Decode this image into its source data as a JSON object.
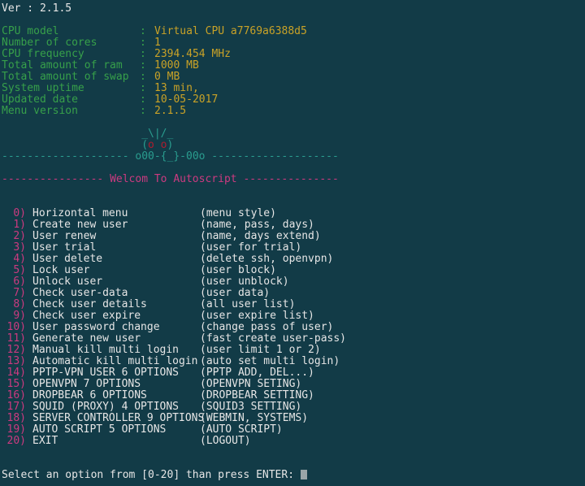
{
  "terminal": {
    "background_color": "#123b47",
    "version_line": "Ver : 2.1.5"
  },
  "colors": {
    "white": "#e6e6e6",
    "green": "#37a04a",
    "yellow": "#c9a227",
    "magenta": "#cc3a80",
    "cyan": "#2a9d8f",
    "red": "#b01c2e",
    "cursor": "#9aa5a8"
  },
  "system_info": {
    "separator": ":",
    "rows": [
      {
        "label": "CPU model",
        "value": "Virtual CPU a7769a6388d5"
      },
      {
        "label": "Number of cores",
        "value": "1"
      },
      {
        "label": "CPU frequency",
        "value": "2394.454 MHz"
      },
      {
        "label": "Total amount of ram",
        "value": "1000 MB"
      },
      {
        "label": "Total amount of swap",
        "value": "0 MB"
      },
      {
        "label": "System uptime",
        "value": "13 min,"
      },
      {
        "label": "Updated date",
        "value": "10-05-2017"
      },
      {
        "label": "Menu version",
        "value": "2.1.5"
      }
    ]
  },
  "ascii_art": {
    "ears": "_\\|/_",
    "face_left": "(",
    "eye_left": "o",
    "face_mid": " ",
    "eye_right": "o",
    "face_right": ")",
    "banner_left_dashes": "--------------------",
    "banner_center": "o00-{_}-00o",
    "banner_right_dashes": "--------------------",
    "welcome_left_dashes": "----------------",
    "welcome_text": "Welcom To Autoscript",
    "welcome_right_dashes": "---------------"
  },
  "menu": {
    "options": [
      {
        "num": "0)",
        "name": "Horizontal menu",
        "desc": "(menu style)"
      },
      {
        "num": "1)",
        "name": "Create new user",
        "desc": "(name, pass, days)"
      },
      {
        "num": "2)",
        "name": "User renew",
        "desc": "(name, days extend)"
      },
      {
        "num": "3)",
        "name": "User trial",
        "desc": "(user for trial)"
      },
      {
        "num": "4)",
        "name": "User delete",
        "desc": "(delete ssh, openvpn)"
      },
      {
        "num": "5)",
        "name": "Lock user",
        "desc": "(user block)"
      },
      {
        "num": "6)",
        "name": "Unlock user",
        "desc": "(user unblock)"
      },
      {
        "num": "7)",
        "name": "Check user-data",
        "desc": "(user data)"
      },
      {
        "num": "8)",
        "name": "Check user details",
        "desc": "(all user list)"
      },
      {
        "num": "9)",
        "name": "Check user expire",
        "desc": "(user expire list)"
      },
      {
        "num": "10)",
        "name": "User password change",
        "desc": "(change pass of user)"
      },
      {
        "num": "11)",
        "name": "Generate new user",
        "desc": "(fast create user-pass)"
      },
      {
        "num": "12)",
        "name": "Manual kill multi login",
        "desc": "(user limit 1 or 2)"
      },
      {
        "num": "13)",
        "name": "Automatic kill multi login",
        "desc": "(auto set multi login)"
      },
      {
        "num": "14)",
        "name": "PPTP-VPN USER 6 OPTIONS",
        "desc": "(PPTP ADD, DEL...)"
      },
      {
        "num": "15)",
        "name": "OPENVPN 7 OPTIONS",
        "desc": "(OPENVPN SETING)"
      },
      {
        "num": "16)",
        "name": "DROPBEAR 6 OPTIONS",
        "desc": "(DROPBEAR SETTING)"
      },
      {
        "num": "17)",
        "name": "SQUID (PROXY) 4 OPTIONS",
        "desc": "(SQUID3 SETTING)"
      },
      {
        "num": "18)",
        "name": "SERVER CONTROLLER 9 OPTIONS",
        "desc": "(WEBMIN, SYSTEMS)"
      },
      {
        "num": "19)",
        "name": "AUTO SCRIPT 5 OPTIONS",
        "desc": "(AUTO SCRIPT)"
      },
      {
        "num": "20)",
        "name": "EXIT",
        "desc": "(LOGOUT)"
      }
    ]
  },
  "prompt": {
    "text": "Select an option from [0-20] than press ENTER:",
    "input_value": ""
  }
}
